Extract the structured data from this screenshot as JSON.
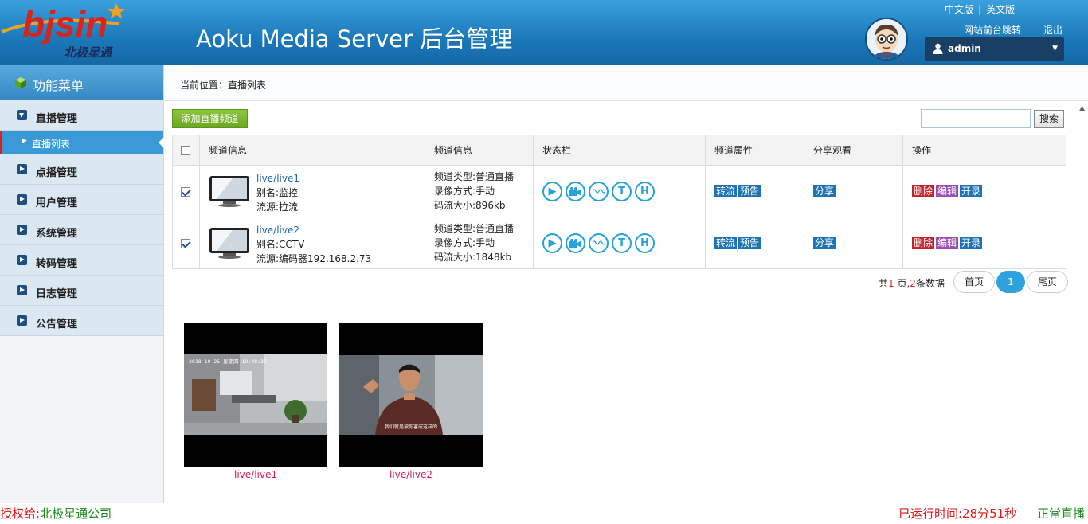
{
  "header": {
    "brand_main": "bjsin",
    "brand_sub": "北极星通",
    "title": "Aoku Media Server 后台管理",
    "lang_cn": "中文版",
    "lang_en": "英文版",
    "front_link": "网站前台跳转",
    "logout": "退出",
    "user": "admin"
  },
  "sidebar": {
    "title": "功能菜单",
    "items": [
      {
        "label": "直播管理"
      },
      {
        "label": "直播列表"
      },
      {
        "label": "点播管理"
      },
      {
        "label": "用户管理"
      },
      {
        "label": "系统管理"
      },
      {
        "label": "转码管理"
      },
      {
        "label": "日志管理"
      },
      {
        "label": "公告管理"
      }
    ]
  },
  "breadcrumb": "当前位置：直播列表",
  "toolbar": {
    "add_label": "添加直播频道",
    "search_label": "搜索",
    "search_value": ""
  },
  "table": {
    "headers": [
      "频道信息",
      "频道信息",
      "状态栏",
      "频道属性",
      "分享观看",
      "操作"
    ],
    "rows": [
      {
        "name": "live/live1",
        "alias": "别名:监控",
        "source": "流源:拉流",
        "type": "频道类型:普通直播",
        "record": "录像方式:手动",
        "bitrate": "码流大小:896kb",
        "attr1": "转流",
        "attr2": "预告",
        "share": "分享",
        "op_delete": "删除",
        "op_edit": "编辑",
        "op_record": "开录"
      },
      {
        "name": "live/live2",
        "alias": "别名:CCTV",
        "source": "流源:编码器192.168.2.73",
        "type": "频道类型:普通直播",
        "record": "录像方式:手动",
        "bitrate": "码流大小:1848kb",
        "attr1": "转流",
        "attr2": "预告",
        "share": "分享",
        "op_delete": "删除",
        "op_edit": "编辑",
        "op_record": "开录"
      }
    ],
    "status_icons": [
      "play-icon",
      "camera-icon",
      "wave-icon",
      "T",
      "H"
    ]
  },
  "pager": {
    "prefix": "共",
    "pages": "1",
    "mid": " 页,",
    "count": "2",
    "suffix": "条数据",
    "first": "首页",
    "current": "1",
    "last": "尾页"
  },
  "thumbs": [
    {
      "label": "live/live1",
      "overlay": "2018 10 25 星期四 19:48:32"
    },
    {
      "label": "live/live2",
      "overlay": "我们就是被你害成这样的"
    }
  ],
  "footer": {
    "license_prefix": "授权给:",
    "license_company": "北极星通公司",
    "runtime": "已运行时间:28分51秒",
    "status": "正常直播"
  }
}
